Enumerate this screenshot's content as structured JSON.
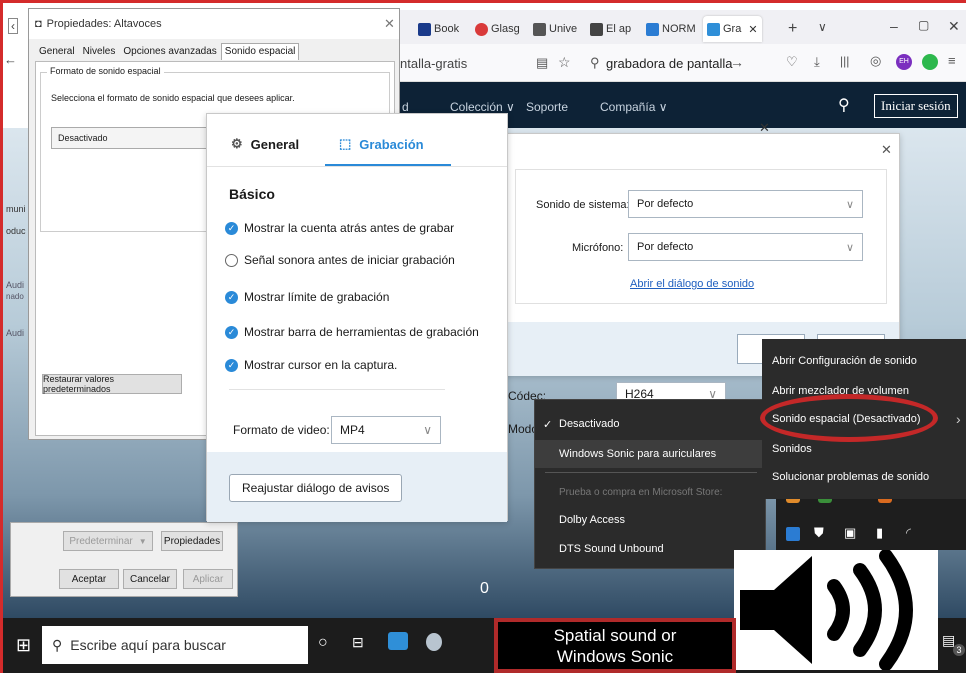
{
  "browser": {
    "tabs": [
      {
        "label": "Book",
        "color": "#1a3a8a"
      },
      {
        "label": "Glasg",
        "color": "#d93a3a"
      },
      {
        "label": "Unive",
        "color": "#555555"
      },
      {
        "label": "El ap",
        "color": "#444444"
      },
      {
        "label": "NORM",
        "color": "#2b7cd3"
      },
      {
        "label": "Gra",
        "color": "#2f8fd8"
      }
    ],
    "url_fragment": "ntalla-gratis",
    "search_text": "grabadora de pantalla",
    "avatar_initials": "EH"
  },
  "website": {
    "nav": [
      "d",
      "Colección ∨",
      "Soporte",
      "Compañía ∨"
    ],
    "login": "Iniciar sesión",
    "left_fragments": [
      "muni",
      "oduc",
      "Audi",
      "nado",
      "Audi"
    ]
  },
  "props_dialog": {
    "title": "Propiedades: Altavoces",
    "tabs": [
      "General",
      "Niveles",
      "Opciones avanzadas",
      "Sonido espacial"
    ],
    "group_label": "Formato de sonido espacial",
    "description": "Selecciona el formato de sonido espacial que desees aplicar.",
    "select_value": "Desactivado",
    "restore_button": "Restaurar valores predeterminados",
    "set_default": "Predeterminar",
    "properties": "Propiedades",
    "ok": "Aceptar",
    "cancel": "Cancelar",
    "apply": "Aplicar"
  },
  "recorder": {
    "tab_general": "General",
    "tab_recording": "Grabación",
    "section_title": "Básico",
    "options": [
      {
        "label": "Mostrar la cuenta atrás antes de grabar",
        "checked": true
      },
      {
        "label": "Señal sonora antes de iniciar grabación",
        "checked": false
      },
      {
        "label": "Mostrar límite de grabación",
        "checked": true
      },
      {
        "label": "Mostrar barra de herramientas de grabación",
        "checked": true
      },
      {
        "label": "Mostrar cursor en la captura.",
        "checked": true
      }
    ],
    "format_label": "Formato de video:",
    "format_value": "MP4",
    "reset_button": "Reajustar diálogo de avisos",
    "codec_label": "Códec:",
    "codec_value": "H264",
    "mode_label": "Modo"
  },
  "audio_dialog": {
    "system_label": "Sonido de sistema:",
    "system_value": "Por defecto",
    "mic_label": "Micrófono:",
    "mic_value": "Por defecto",
    "sound_link": "Abrir el diálogo de sonido"
  },
  "spatial_menu": {
    "items": [
      "Desactivado",
      "Windows Sonic para auriculares"
    ],
    "store_header": "Prueba o compra en Microsoft Store:",
    "store_items": [
      "Dolby Access",
      "DTS Sound Unbound"
    ]
  },
  "context_menu": {
    "items": [
      "Abrir Configuración de sonido",
      "Abrir mezclador de volumen",
      "Sonido espacial (Desactivado)",
      "Sonidos",
      "Solucionar problemas de sonido"
    ]
  },
  "taskbar": {
    "search_placeholder": "Escribe aquí para buscar",
    "notification_count": "3"
  },
  "caption": {
    "line1": "Spatial sound or",
    "line2": "Windows Sonic"
  },
  "cursor_text": "0",
  "colors": {
    "accent_blue": "#2a8ad8",
    "highlight_red": "#c42828",
    "nav_dark": "#0d2236"
  }
}
